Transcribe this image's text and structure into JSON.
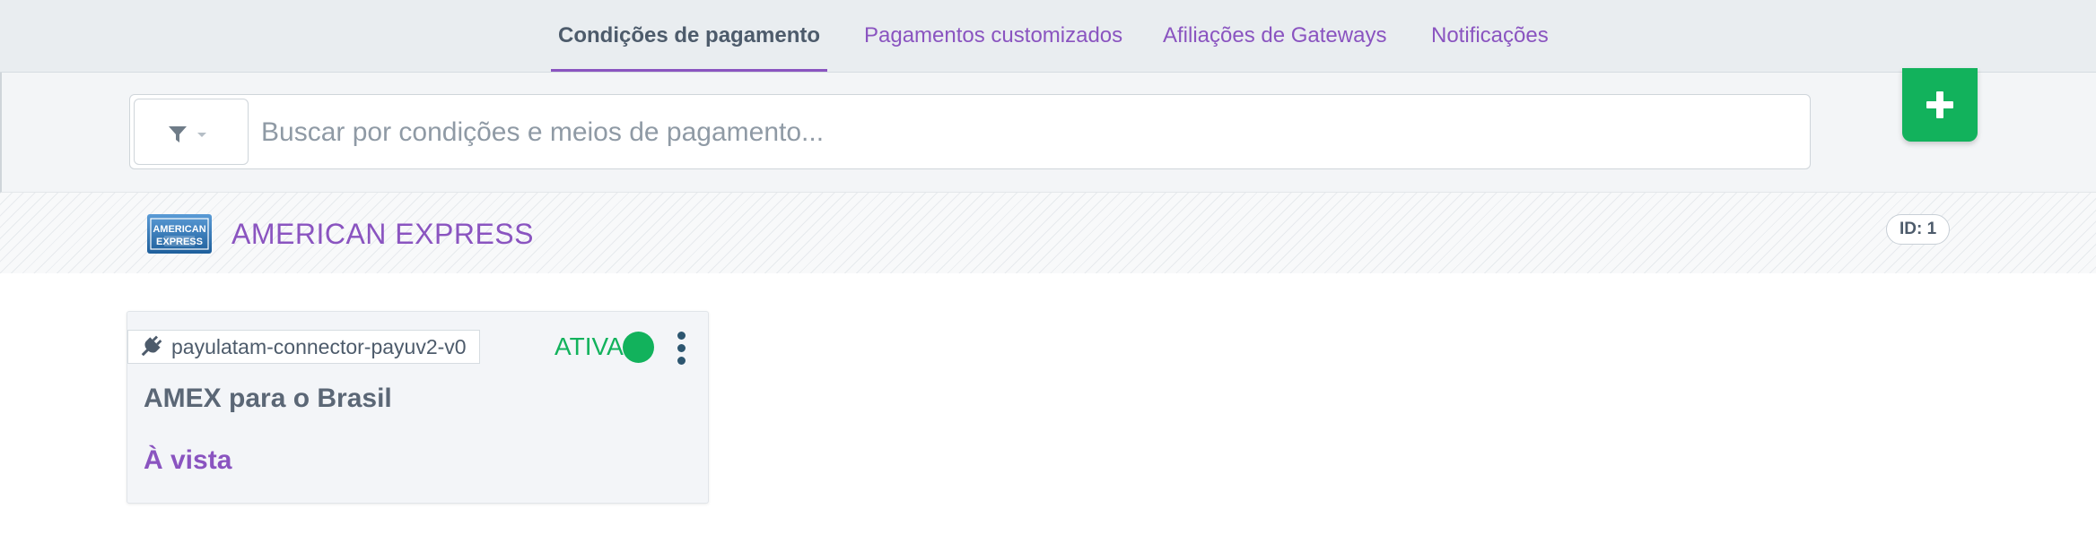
{
  "tabs": [
    {
      "label": "Condições de pagamento",
      "active": true
    },
    {
      "label": "Pagamentos customizados",
      "active": false
    },
    {
      "label": "Afiliações de Gateways",
      "active": false
    },
    {
      "label": "Notificações",
      "active": false
    }
  ],
  "search": {
    "placeholder": "Buscar por condições e meios de pagamento...",
    "value": "",
    "filter_icon": "filter-icon",
    "caret_icon": "caret-down-icon"
  },
  "add_button": {
    "icon": "plus-icon",
    "color": "#12b25c"
  },
  "section": {
    "logo_text_top": "AMERICAN",
    "logo_text_bottom": "EXPRESS",
    "name": "AMERICAN EXPRESS",
    "id_label": "ID: 1"
  },
  "card": {
    "connector_icon": "plug-icon",
    "connector": "payulatam-connector-payuv2-v0",
    "status": "ATIVA",
    "status_color": "#12b25c",
    "title": "AMEX para o Brasil",
    "subtitle": "À vista",
    "menu_icon": "kebab-menu-icon"
  },
  "colors": {
    "accent": "#8a54c0",
    "text": "#4d5b6b",
    "success": "#12b25c"
  }
}
